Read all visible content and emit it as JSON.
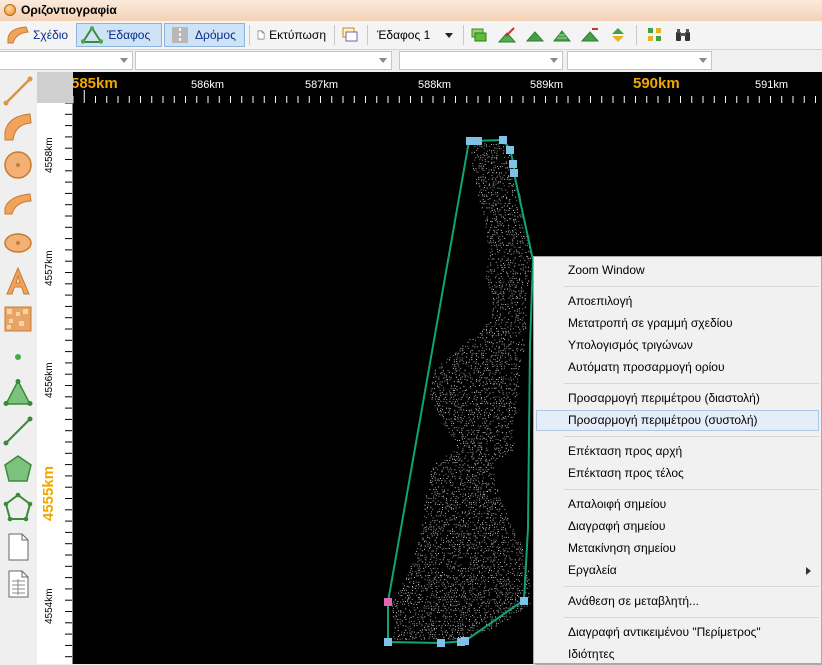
{
  "window": {
    "title": "Οριζοντιογραφία"
  },
  "toolbar": {
    "design_label": "Σχέδιο",
    "terrain_label": "Έδαφος",
    "road_label": "Δρόμος",
    "print_label": "Εκτύπωση",
    "layer_select": "Έδαφος 1"
  },
  "ruler": {
    "x_labels": [
      {
        "text": "585km",
        "major": true
      },
      {
        "text": "586km",
        "major": false
      },
      {
        "text": "587km",
        "major": false
      },
      {
        "text": "588km",
        "major": false
      },
      {
        "text": "589km",
        "major": false
      },
      {
        "text": "590km",
        "major": true
      },
      {
        "text": "591km",
        "major": false
      }
    ],
    "y_labels": [
      {
        "text": "4558km",
        "major": false
      },
      {
        "text": "4557km",
        "major": false
      },
      {
        "text": "4556km",
        "major": false
      },
      {
        "text": "4555km",
        "major": true
      },
      {
        "text": "4554km",
        "major": false
      }
    ]
  },
  "colors": {
    "perimeter": "#0fa37a",
    "vertex": "#7ec3e6",
    "selected_vertex": "#e066b0",
    "major_label": "#f0a800"
  },
  "context_menu": {
    "items": [
      {
        "label": "Zoom Window"
      },
      {
        "sep": true
      },
      {
        "label": "Αποεπιλογή"
      },
      {
        "label": "Μετατροπή σε γραμμή σχεδίου"
      },
      {
        "label": "Υπολογισμός τριγώνων"
      },
      {
        "label": "Αυτόματη προσαρμογή ορίου"
      },
      {
        "sep": true
      },
      {
        "label": "Προσαρμογή περιμέτρου (διαστολή)"
      },
      {
        "label": "Προσαρμογή περιμέτρου (συστολή)",
        "highlighted": true
      },
      {
        "sep": true
      },
      {
        "label": "Επέκταση προς αρχή"
      },
      {
        "label": "Επέκταση προς τέλος"
      },
      {
        "sep": true
      },
      {
        "label": "Απαλοιφή σημείου"
      },
      {
        "label": "Διαγραφή σημείου"
      },
      {
        "label": "Μετακίνηση σημείου"
      },
      {
        "label": "Εργαλεία",
        "submenu": true
      },
      {
        "sep": true
      },
      {
        "label": "Ανάθεση σε μεταβλητή..."
      },
      {
        "sep": true
      },
      {
        "label": "Διαγραφή αντικειμένου \"Περίμετρος\""
      },
      {
        "label": "Ιδιότητες"
      }
    ]
  }
}
